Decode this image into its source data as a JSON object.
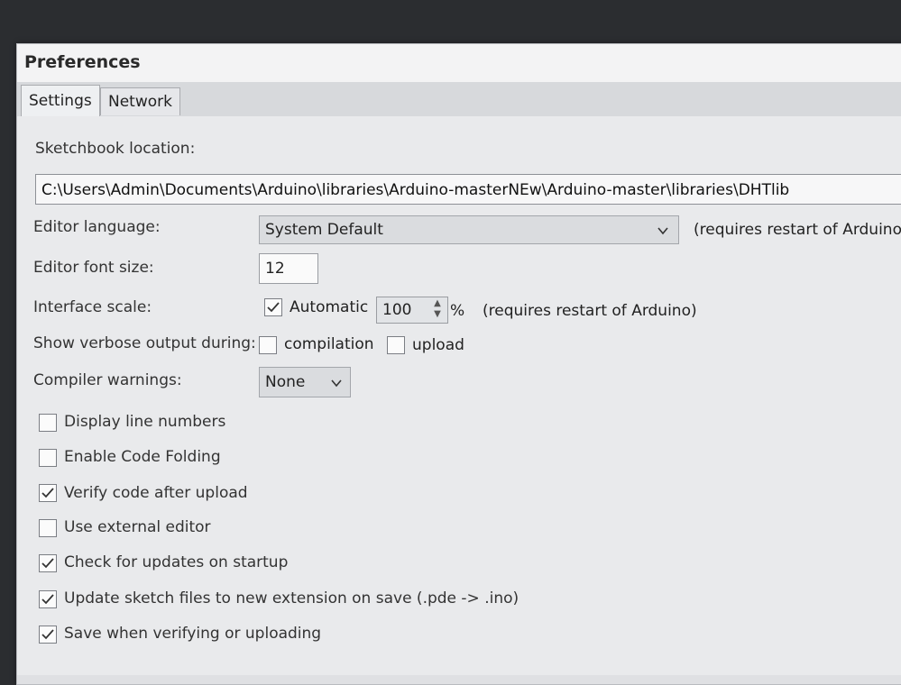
{
  "window": {
    "title": "Preferences"
  },
  "tabs": [
    {
      "label": "Settings"
    },
    {
      "label": "Network"
    }
  ],
  "settings": {
    "sketchbook_label": "Sketchbook location:",
    "sketchbook_path": "C:\\Users\\Admin\\Documents\\Arduino\\libraries\\Arduino-masterNEw\\Arduino-master\\libraries\\DHTlib",
    "editor_language_label": "Editor language:",
    "editor_language_value": "System Default",
    "editor_language_note": "(requires restart of Arduino)",
    "font_size_label": "Editor font size:",
    "font_size_value": "12",
    "interface_scale_label": "Interface scale:",
    "automatic_label": "Automatic",
    "scale_value": "100",
    "scale_unit": "%",
    "scale_note": "(requires restart of Arduino)",
    "verbose_label": "Show verbose output during:",
    "compilation_label": "compilation",
    "upload_label": "upload",
    "compiler_warnings_label": "Compiler warnings:",
    "compiler_warnings_value": "None",
    "checkboxes": [
      {
        "label": "Display line numbers",
        "checked": false
      },
      {
        "label": "Enable Code Folding",
        "checked": false
      },
      {
        "label": "Verify code after upload",
        "checked": true
      },
      {
        "label": "Use external editor",
        "checked": false
      },
      {
        "label": "Check for updates on startup",
        "checked": true
      },
      {
        "label": "Update sketch files to new extension on save (.pde -> .ino)",
        "checked": true
      },
      {
        "label": "Save when verifying or uploading",
        "checked": true
      }
    ]
  }
}
